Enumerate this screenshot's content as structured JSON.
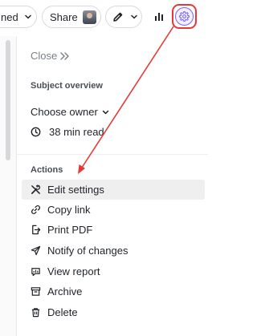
{
  "toolbar": {
    "status_label": "ned",
    "share_label": "Share",
    "edit_icon": "pencil-icon",
    "stats_icon": "bar-chart-icon",
    "settings_icon": "gear-icon"
  },
  "panel": {
    "close_label": "Close",
    "subject_overview_title": "Subject overview",
    "owner_label": "Choose owner",
    "read_time": "38 min read",
    "actions_title": "Actions",
    "actions": [
      {
        "label": "Edit settings",
        "icon": "tools-icon",
        "active": true
      },
      {
        "label": "Copy link",
        "icon": "link-icon"
      },
      {
        "label": "Print PDF",
        "icon": "export-icon"
      },
      {
        "label": "Notify of changes",
        "icon": "send-icon"
      },
      {
        "label": "View report",
        "icon": "report-icon"
      },
      {
        "label": "Archive",
        "icon": "archive-icon"
      },
      {
        "label": "Delete",
        "icon": "trash-icon"
      }
    ]
  },
  "colors": {
    "highlight": "#e53935",
    "accent": "#7b61ff"
  }
}
